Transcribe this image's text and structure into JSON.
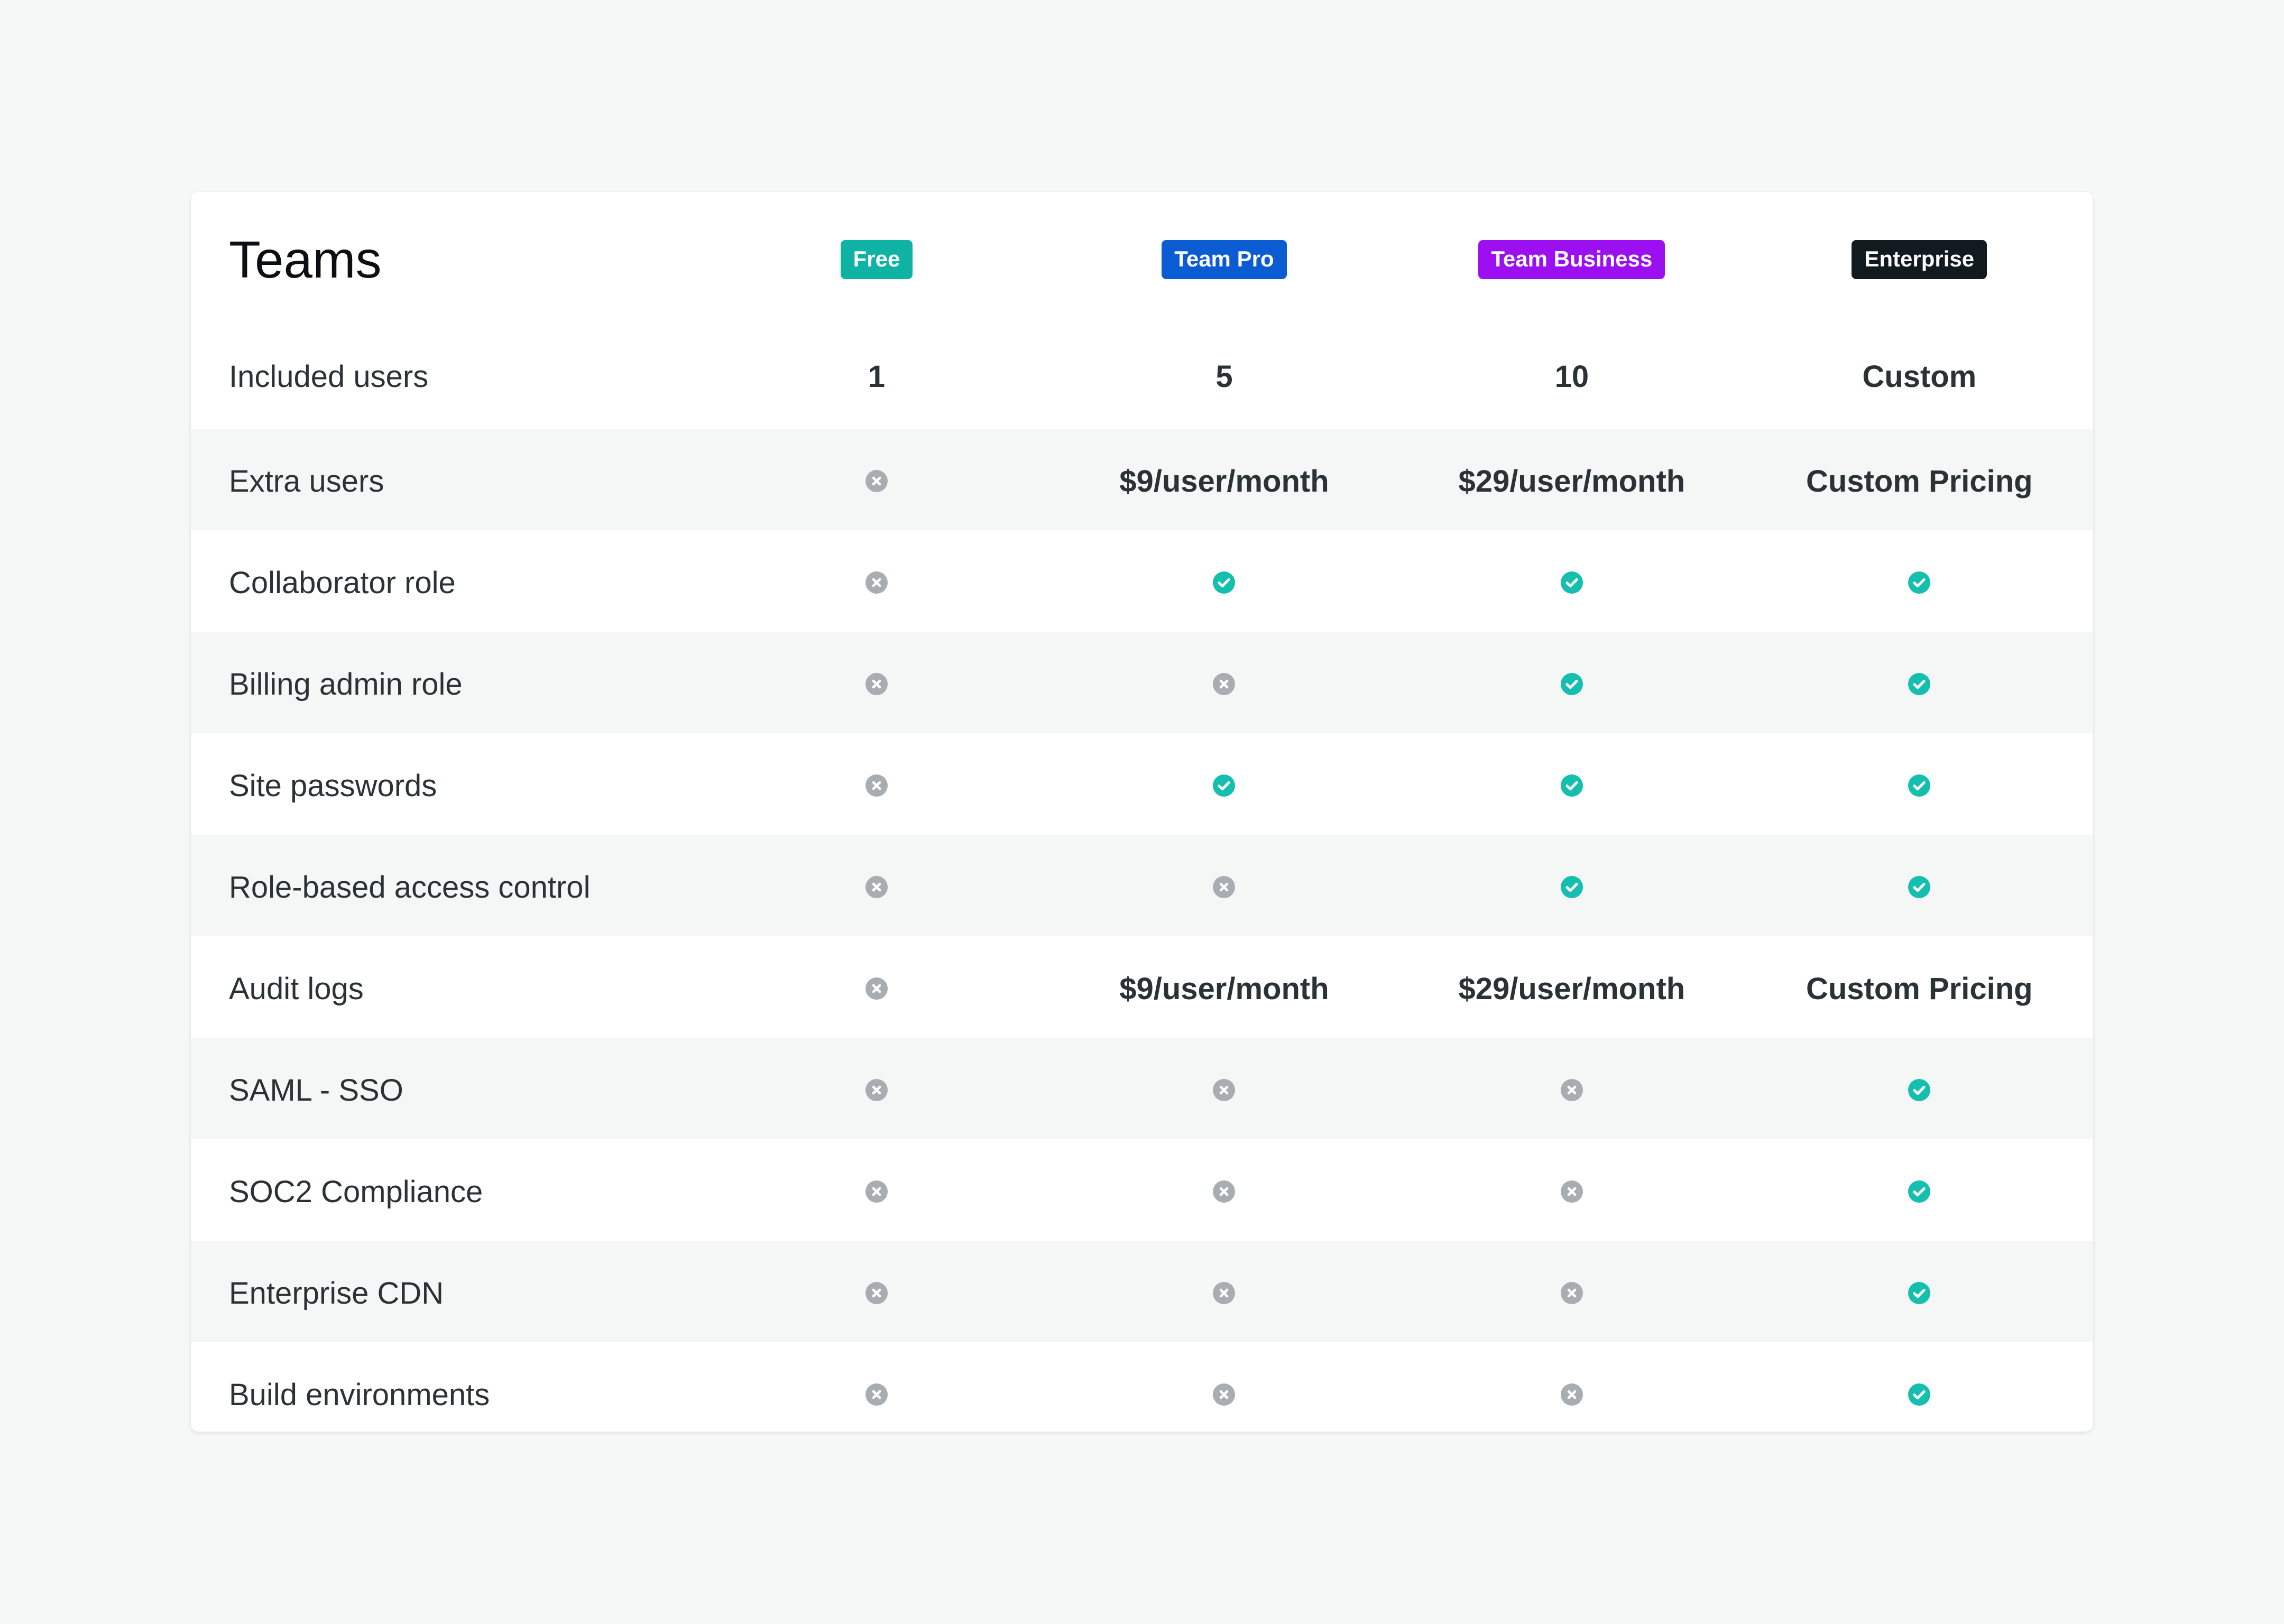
{
  "table": {
    "title": "Teams",
    "plans": [
      {
        "name": "Free",
        "color": "#0eb3a3"
      },
      {
        "name": "Team Pro",
        "color": "#0b5cd2"
      },
      {
        "name": "Team Business",
        "color": "#9b0ff0"
      },
      {
        "name": "Enterprise",
        "color": "#101a1f"
      }
    ],
    "rows": [
      {
        "label": "Included users",
        "values": [
          "1",
          "5",
          "10",
          "Custom"
        ]
      },
      {
        "label": "Extra users",
        "values": [
          "cross",
          "$9/user/month",
          "$29/user/month",
          "Custom Pricing"
        ]
      },
      {
        "label": "Collaborator role",
        "values": [
          "cross",
          "check",
          "check",
          "check"
        ]
      },
      {
        "label": "Billing admin role",
        "values": [
          "cross",
          "cross",
          "check",
          "check"
        ]
      },
      {
        "label": "Site passwords",
        "values": [
          "cross",
          "check",
          "check",
          "check"
        ]
      },
      {
        "label": "Role-based access control",
        "values": [
          "cross",
          "cross",
          "check",
          "check"
        ]
      },
      {
        "label": "Audit logs",
        "values": [
          "cross",
          "$9/user/month",
          "$29/user/month",
          "Custom Pricing"
        ]
      },
      {
        "label": "SAML - SSO",
        "values": [
          "cross",
          "cross",
          "cross",
          "check"
        ]
      },
      {
        "label": "SOC2 Compliance",
        "values": [
          "cross",
          "cross",
          "cross",
          "check"
        ]
      },
      {
        "label": "Enterprise CDN",
        "values": [
          "cross",
          "cross",
          "cross",
          "check"
        ]
      },
      {
        "label": "Build environments",
        "values": [
          "cross",
          "cross",
          "cross",
          "check"
        ]
      }
    ]
  },
  "icons": {
    "check": {
      "name": "check-circle-icon",
      "color": "#14bfae"
    },
    "cross": {
      "name": "x-circle-icon",
      "color": "#a7adb1"
    }
  }
}
